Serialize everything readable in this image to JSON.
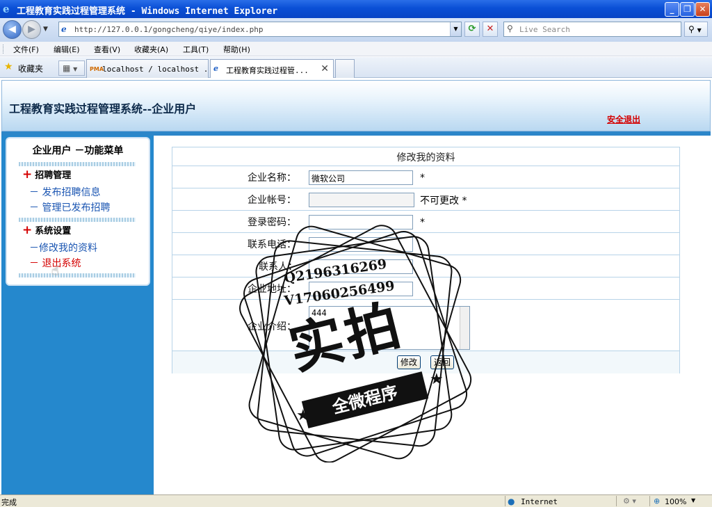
{
  "window": {
    "title": "工程教育实践过程管理系统 - Windows Internet Explorer"
  },
  "address": {
    "url": "http://127.0.0.1/gongcheng/qiye/index.php",
    "search_placeholder": "Live Search"
  },
  "menu": [
    "文件(F)",
    "编辑(E)",
    "查看(V)",
    "收藏夹(A)",
    "工具(T)",
    "帮助(H)"
  ],
  "favorites_label": "收藏夹",
  "tabs": [
    {
      "label": "localhost / localhost ...",
      "icon": "PMA"
    },
    {
      "label": "工程教育实践过程管...",
      "icon": "e"
    }
  ],
  "header": {
    "title": "工程教育实践过程管理系统--企业用户",
    "logout": "安全退出"
  },
  "sidebar": {
    "title": "企业用户 －功能菜单",
    "groups": [
      {
        "label": "招聘管理",
        "items": [
          "－ 发布招聘信息",
          "－ 管理已发布招聘"
        ]
      },
      {
        "label": "系统设置",
        "items": [
          "－修改我的资料",
          "－ 退出系统"
        ]
      }
    ]
  },
  "form": {
    "title": "修改我的资料",
    "fields": [
      {
        "label": "企业名称：",
        "value": "微软公司",
        "note": "*"
      },
      {
        "label": "企业帐号：",
        "value": "",
        "note": "不可更改 *"
      },
      {
        "label": "登录密码：",
        "value": "",
        "note": "*"
      },
      {
        "label": "联系电话：",
        "value": "",
        "note": ""
      },
      {
        "label": "联系人：",
        "value": "",
        "note": ""
      },
      {
        "label": "企业地址：",
        "value": "",
        "note": ""
      },
      {
        "label": "企业介绍：",
        "value": "444",
        "note": ""
      }
    ],
    "submit": "修改",
    "back": "返回"
  },
  "watermark": {
    "qq": "Q2196316269",
    "wechat": "V17060256499",
    "main": "实拍",
    "banner": "全微程序"
  },
  "status": {
    "text": "完成",
    "zone": "Internet",
    "zoom": "100%"
  },
  "colors": {
    "sidebar_bg": "#2588cd",
    "logout_red": "#d40000",
    "link_blue": "#1a55b2"
  }
}
